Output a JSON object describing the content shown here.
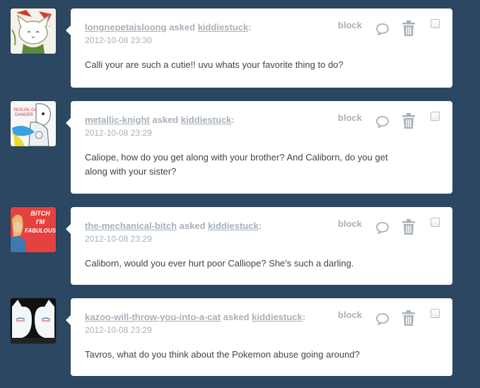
{
  "posts": [
    {
      "asker": "longnepetaisloong",
      "asked_word": "asked",
      "recipient": "kiddiestuck",
      "colon": ":",
      "timestamp": "2012-10-08 23:30",
      "question": "Calli your are such a cutie!! uvu whats your favorite thing to do?",
      "block_label": "block",
      "avatar_icon": "cat-hat-avatar",
      "avatar_text": ""
    },
    {
      "asker": "metallic-knight",
      "asked_word": "asked",
      "recipient": "kiddiestuck",
      "colon": ":",
      "timestamp": "2012-10-08 23:29",
      "question": "Caliope, how do you get along with your brother? And Caliborn, do you get along with your sister?",
      "block_label": "block",
      "avatar_icon": "sketch-character-avatar",
      "avatar_text": ""
    },
    {
      "asker": "the-mechanical-bitch",
      "asked_word": "asked",
      "recipient": "kiddiestuck",
      "colon": ":",
      "timestamp": "2012-10-08 23:29",
      "question": "Caliborn, would you ever hurt poor Calliope? She's such a darling.",
      "block_label": "block",
      "avatar_icon": "fabulous-avatar",
      "avatar_text_lines": [
        "BITCH",
        "I'M",
        "FABULOUS"
      ]
    },
    {
      "asker": "kazoo-will-throw-you-into-a-cat",
      "asked_word": "asked",
      "recipient": "kiddiestuck",
      "colon": ":",
      "timestamp": "2012-10-08 23:29",
      "question": "Tavros, what do you think about the Pokemon abuse going around?",
      "block_label": "block",
      "avatar_icon": "white-cats-avatar",
      "avatar_text": ""
    }
  ],
  "colors": {
    "background": "#2c4762",
    "meta_text": "#a8b1ba",
    "body_text": "#444444"
  }
}
